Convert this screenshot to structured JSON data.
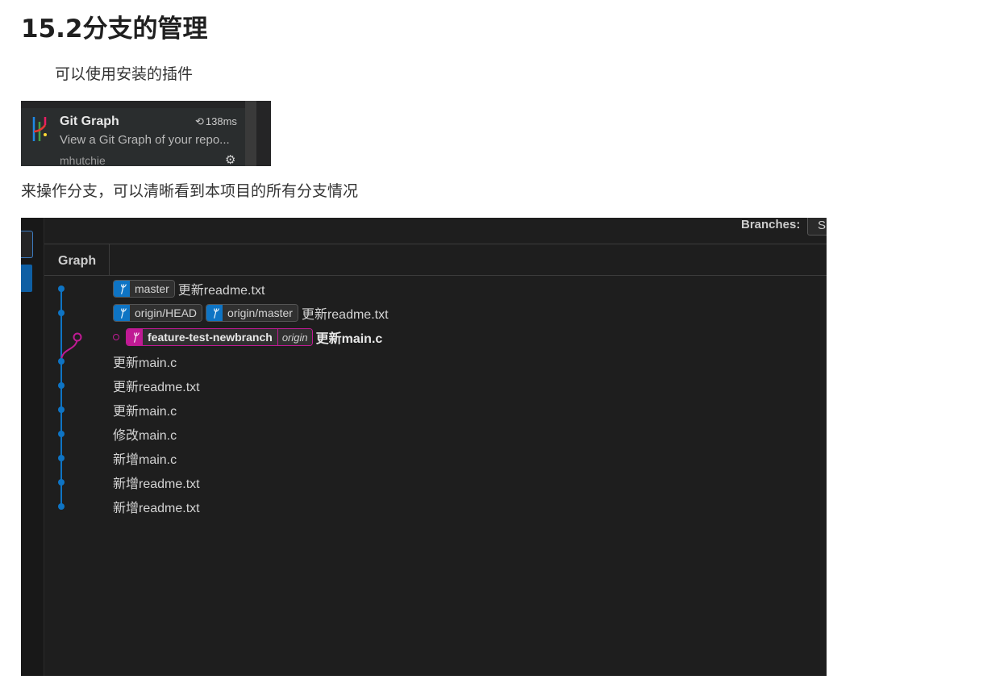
{
  "heading": "15.2分支的管理",
  "intro": "可以使用安装的插件",
  "extension": {
    "name": "Git Graph",
    "time": "138ms",
    "description": "View a Git Graph of your repo...",
    "author": "mhutchie"
  },
  "outro": "来操作分支，可以清晰看到本项目的所有分支情况",
  "git_graph": {
    "branches_label": "Branches:",
    "branches_value": "S",
    "column_header": "Graph",
    "colors": {
      "main_line": "#0e74c4",
      "feature_line": "#c01a94"
    },
    "commits": [
      {
        "refs": [
          "master"
        ],
        "message": "更新readme.txt",
        "branch": "main"
      },
      {
        "refs": [
          "origin/HEAD",
          "origin/master"
        ],
        "message": "更新readme.txt",
        "branch": "main"
      },
      {
        "refs": [
          "feature-test-newbranch"
        ],
        "remote": "origin",
        "message": "更新main.c",
        "branch": "feature",
        "selected": true
      },
      {
        "message": "更新main.c",
        "branch": "main"
      },
      {
        "message": "更新readme.txt",
        "branch": "main"
      },
      {
        "message": "更新main.c",
        "branch": "main"
      },
      {
        "message": "修改main.c",
        "branch": "main"
      },
      {
        "message": "新增main.c",
        "branch": "main"
      },
      {
        "message": "新增readme.txt",
        "branch": "main"
      },
      {
        "message": "新增readme.txt",
        "branch": "main"
      }
    ]
  }
}
